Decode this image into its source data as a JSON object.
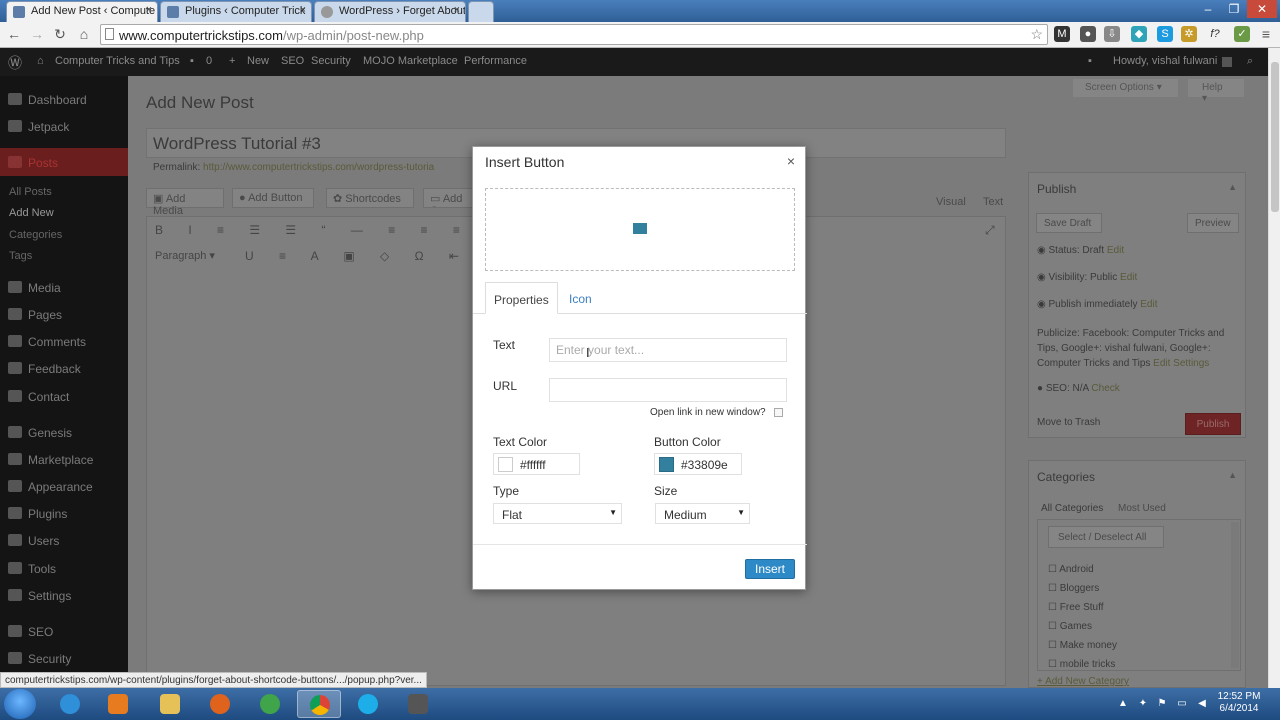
{
  "browser": {
    "tabs": [
      {
        "title": "Add New Post ‹ Compute",
        "active": true
      },
      {
        "title": "Plugins ‹ Computer Trick",
        "active": false
      },
      {
        "title": "WordPress › Forget About",
        "active": false
      }
    ],
    "url_host": "www.computertrickstips.com",
    "url_path": "/wp-admin/post-new.php",
    "status_url": "computertrickstips.com/wp-content/plugins/forget-about-shortcode-buttons/.../popup.php?ver..."
  },
  "adminbar": {
    "site_name": "Computer Tricks and Tips",
    "comments_count": "0",
    "items": [
      "New",
      "SEO",
      "Security",
      "MOJO Marketplace",
      "Performance"
    ],
    "howdy": "Howdy, vishal fulwani"
  },
  "sidebar": {
    "items": [
      {
        "label": "Dashboard"
      },
      {
        "label": "Jetpack"
      },
      {
        "label": "Posts"
      },
      {
        "label": "All Posts"
      },
      {
        "label": "Add New"
      },
      {
        "label": "Categories"
      },
      {
        "label": "Tags"
      },
      {
        "label": "Media"
      },
      {
        "label": "Pages"
      },
      {
        "label": "Comments"
      },
      {
        "label": "Feedback"
      },
      {
        "label": "Contact"
      },
      {
        "label": "Genesis"
      },
      {
        "label": "Marketplace"
      },
      {
        "label": "Appearance"
      },
      {
        "label": "Plugins"
      },
      {
        "label": "Users"
      },
      {
        "label": "Tools"
      },
      {
        "label": "Settings"
      },
      {
        "label": "SEO"
      },
      {
        "label": "Security"
      }
    ]
  },
  "editor": {
    "page_title": "Add New Post",
    "post_title": "WordPress Tutorial #3",
    "permalink_label": "Permalink:",
    "permalink_url": "http://www.computertrickstips.com/wordpress-tutoria",
    "add_media": "Add Media",
    "add_button": "Add Button",
    "shortcodes": "Shortcodes",
    "add_c": "Add C",
    "visual": "Visual",
    "text": "Text",
    "paragraph": "Paragraph",
    "screen_options": "Screen Options",
    "help": "Help"
  },
  "publish": {
    "heading": "Publish",
    "save_draft": "Save Draft",
    "preview": "Preview",
    "status": "Status: Draft",
    "visibility": "Visibility: Public",
    "publish_when": "Publish immediately",
    "edit": "Edit",
    "publicize": "Publicize: Facebook: Computer Tricks and Tips, Google+: vishal fulwani, Google+: Computer Tricks and Tips",
    "settings": "Settings",
    "seo": "SEO: N/A",
    "check": "Check",
    "trash": "Move to Trash",
    "publish_btn": "Publish"
  },
  "categories": {
    "heading": "Categories",
    "tab_all": "All Categories",
    "tab_most": "Most Used",
    "select_all": "Select / Deselect All",
    "items": [
      "Android",
      "Bloggers",
      "Free Stuff",
      "Games",
      "Make money",
      "mobile tricks"
    ],
    "add_new": "+ Add New Category"
  },
  "modal": {
    "title": "Insert Button",
    "close": "×",
    "tab_properties": "Properties",
    "tab_icon": "Icon",
    "text_label": "Text",
    "text_placeholder": "Enter your text...",
    "url_label": "URL",
    "new_window_label": "Open link in new window?",
    "text_color_label": "Text Color",
    "text_color": "#ffffff",
    "button_color_label": "Button Color",
    "button_color": "#33809e",
    "type_label": "Type",
    "type_value": "Flat",
    "size_label": "Size",
    "size_value": "Medium",
    "insert": "Insert"
  },
  "taskbar": {
    "time": "12:52 PM",
    "date": "6/4/2014"
  }
}
